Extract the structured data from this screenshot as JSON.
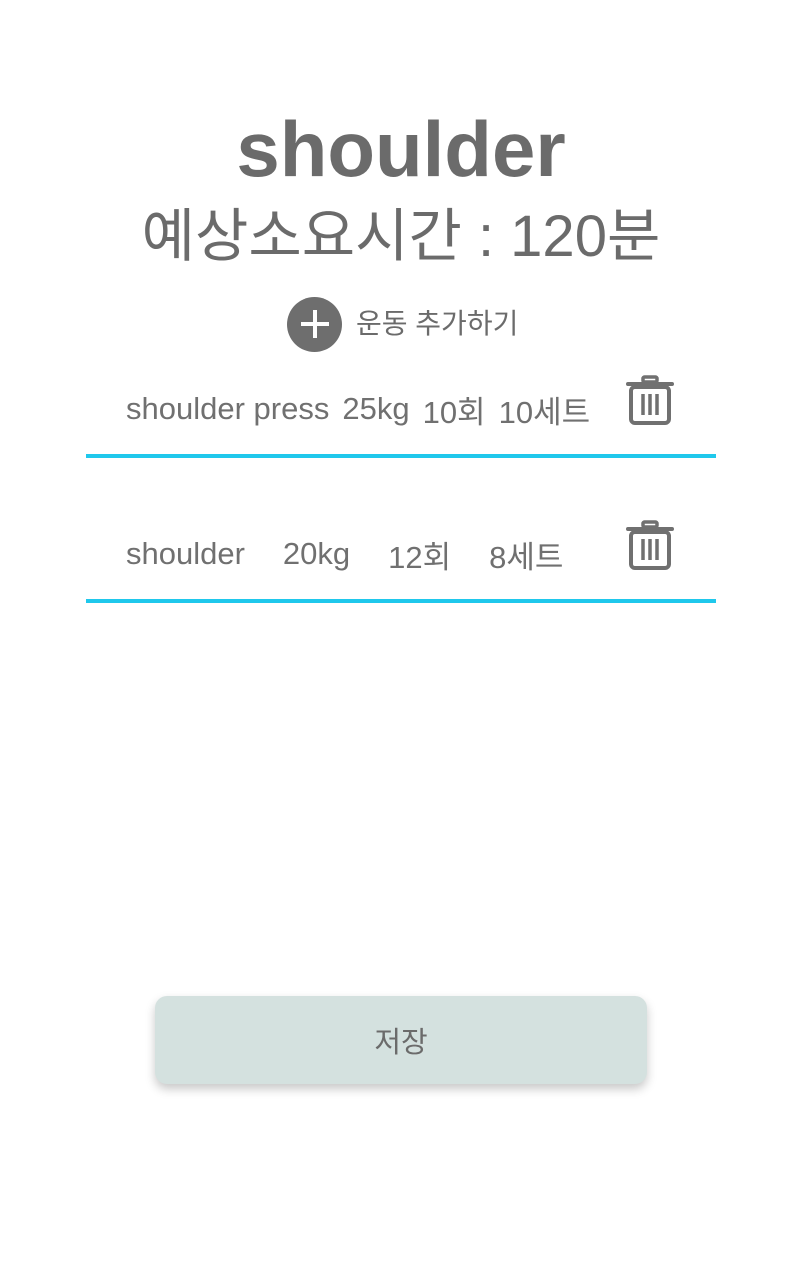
{
  "routine": {
    "title": "shoulder",
    "duration_label": "예상소요시간 : 120분"
  },
  "add_exercise": {
    "label": "운동 추가하기",
    "icon": "plus-circle-icon"
  },
  "exercises": [
    {
      "name": "shoulder press",
      "weight": "25kg",
      "reps": "10회",
      "sets": "10세트",
      "delete_icon": "trash-icon"
    },
    {
      "name": "shoulder",
      "weight": "20kg",
      "reps": "12회",
      "sets": "8세트",
      "delete_icon": "trash-icon"
    }
  ],
  "save_button": {
    "label": "저장"
  },
  "colors": {
    "text": "#6b6b6b",
    "underline_accent": "#1fc8ec",
    "save_button_bg": "#d4e1df",
    "add_icon_bg": "#6e6e6e"
  }
}
